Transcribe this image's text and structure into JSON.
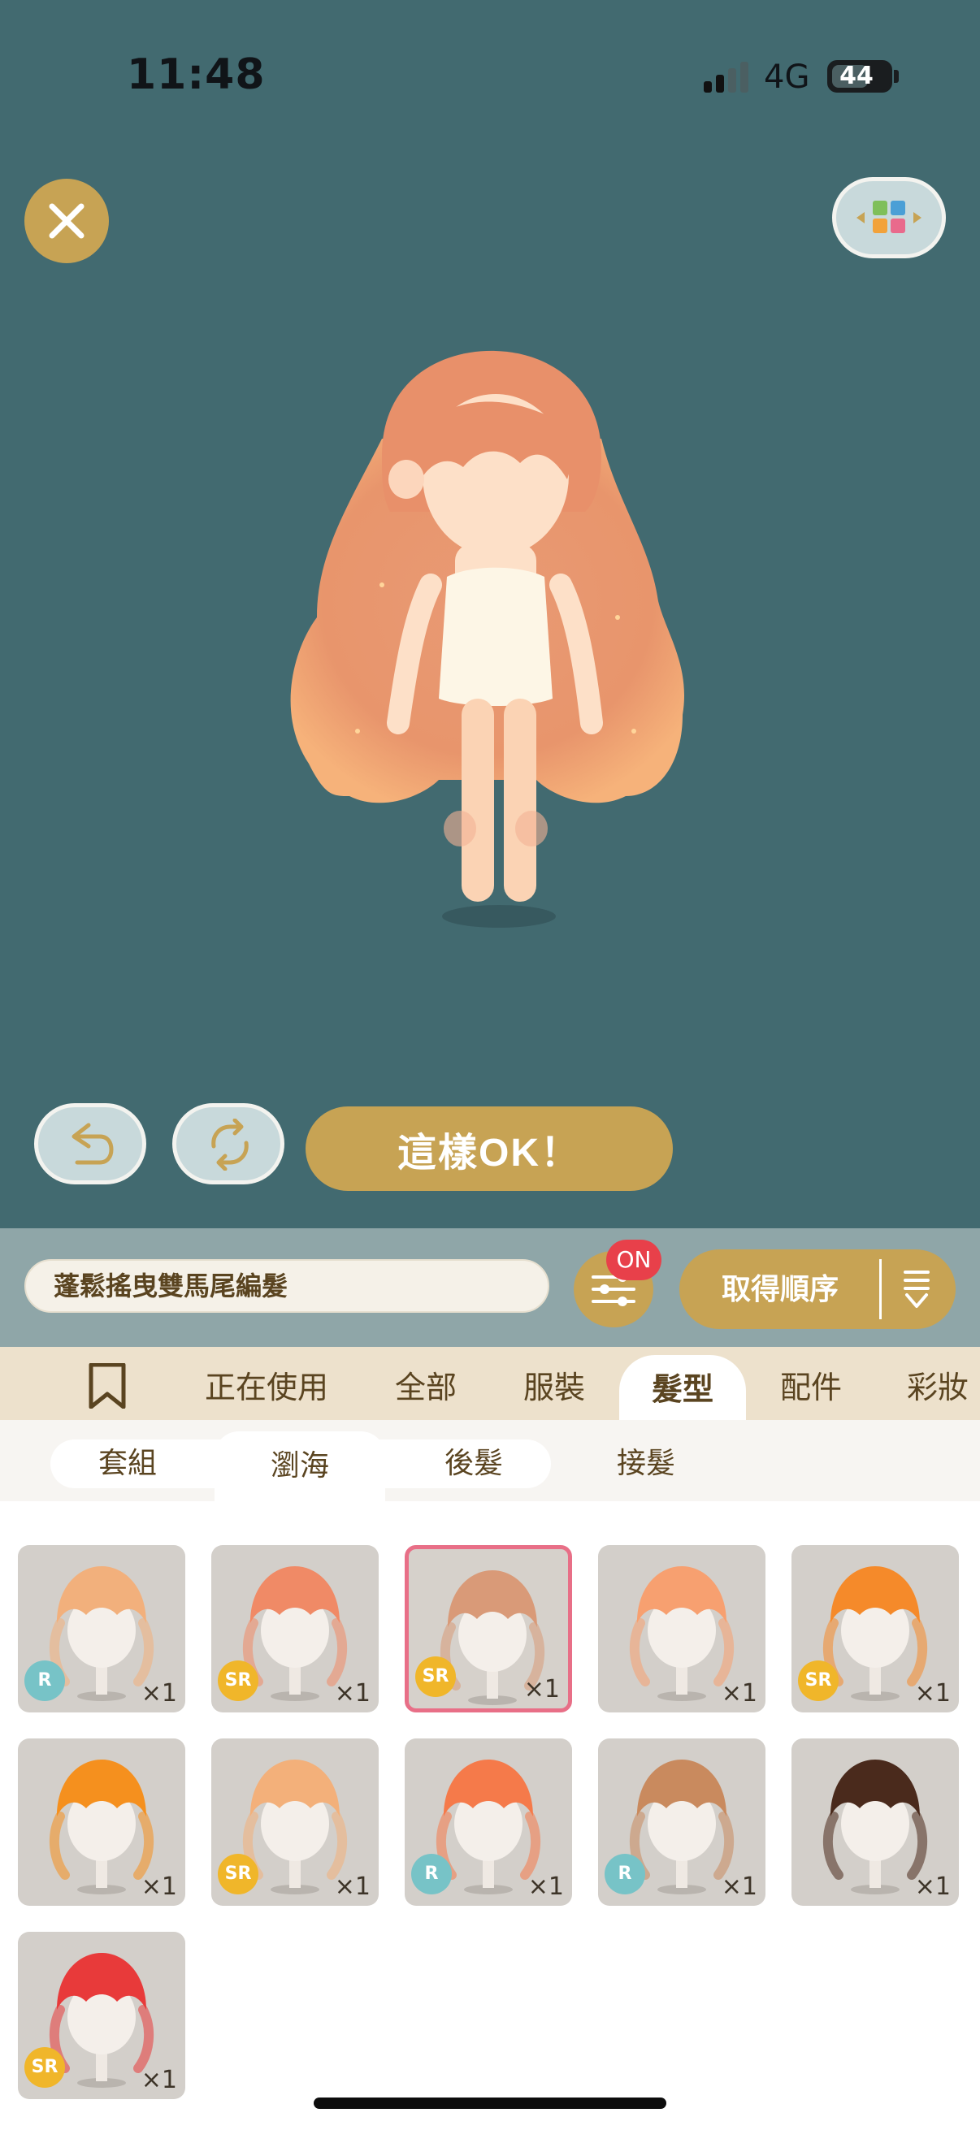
{
  "status_bar": {
    "time": "11:48",
    "network": "4G",
    "battery": "44"
  },
  "preview": {
    "close_icon": "close-icon",
    "layout_icon": "layout-switch-icon",
    "undo_icon": "undo-icon",
    "shuffle_icon": "shuffle-icon",
    "ok_label": "這樣OK！",
    "hair_color": "#e89a6e",
    "background": "#426a70"
  },
  "name_bar": {
    "item_name": "蓬鬆搖曳雙馬尾編髮",
    "filter_badge": "ON",
    "sort_label": "取得順序"
  },
  "category_tabs": [
    {
      "label": "正在使用"
    },
    {
      "label": "全部"
    },
    {
      "label": "服裝"
    },
    {
      "label": "髮型",
      "active": true
    },
    {
      "label": "配件"
    },
    {
      "label": "彩妝"
    }
  ],
  "sub_tabs": [
    {
      "label": "套組"
    },
    {
      "label": "瀏海",
      "active": true
    },
    {
      "label": "後髮"
    },
    {
      "label": "接髮"
    }
  ],
  "items": [
    {
      "rarity": "R",
      "qty": "×1",
      "color": "#f2b07c"
    },
    {
      "rarity": "SR",
      "qty": "×1",
      "color": "#f08a66"
    },
    {
      "rarity": "SR",
      "qty": "×1",
      "color": "#d99a78",
      "selected": true
    },
    {
      "rarity": "",
      "qty": "×1",
      "color": "#f7a070"
    },
    {
      "rarity": "SR",
      "qty": "×1",
      "color": "#f58a2a"
    },
    {
      "rarity": "",
      "qty": "×1",
      "color": "#f5901e"
    },
    {
      "rarity": "SR",
      "qty": "×1",
      "color": "#f3b07a"
    },
    {
      "rarity": "R",
      "qty": "×1",
      "color": "#f57a4a"
    },
    {
      "rarity": "R",
      "qty": "×1",
      "color": "#c98a5e"
    },
    {
      "rarity": "",
      "qty": "×1",
      "color": "#4a2a1c"
    },
    {
      "rarity": "SR",
      "qty": "×1",
      "color": "#e83a3a"
    }
  ]
}
